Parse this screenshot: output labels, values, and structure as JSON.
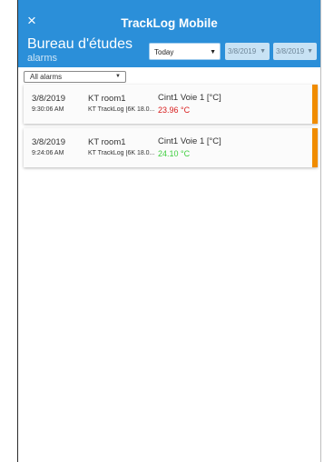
{
  "colors": {
    "header_bg": "#2b8fd9",
    "alarm_stripe": "#f08c00",
    "value_red": "#d81b1b",
    "value_green": "#3ecf3e"
  },
  "header": {
    "close_icon": "close-icon",
    "close_glyph": "×",
    "app_title": "TrackLog Mobile",
    "subtitle": "Bureau d'études",
    "subsubtitle": "alarms"
  },
  "filters": {
    "period": "Today",
    "date_from": "3/8/2019",
    "date_to": "3/8/2019",
    "alarm_filter": "All alarms",
    "dropdown_glyph": "▼"
  },
  "alarms": [
    {
      "date": "3/8/2019",
      "time": "9:30:06 AM",
      "room": "KT room1",
      "device": "KT TrackLog [6K 18.0...",
      "channel": "Cint1 Voie 1 [°C]",
      "value": "23.96 °C",
      "value_color": "#d81b1b"
    },
    {
      "date": "3/8/2019",
      "time": "9:24:06 AM",
      "room": "KT room1",
      "device": "KT TrackLog [6K 18.0...",
      "channel": "Cint1 Voie 1 [°C]",
      "value": "24.10 °C",
      "value_color": "#3ecf3e"
    }
  ]
}
